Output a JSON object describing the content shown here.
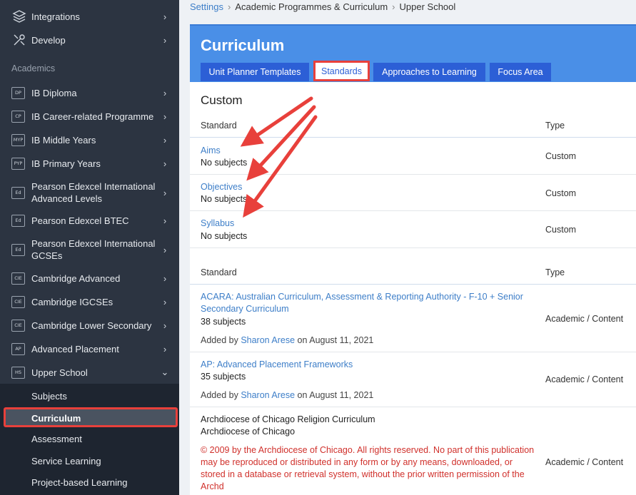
{
  "sidebar": {
    "top_items": [
      {
        "label": "Integrations",
        "icon": "layers-icon"
      },
      {
        "label": "Develop",
        "icon": "tools-icon"
      }
    ],
    "section_heading": "Academics",
    "programmes": [
      {
        "badge": "DP",
        "label": "IB Diploma"
      },
      {
        "badge": "CP",
        "label": "IB Career-related Programme"
      },
      {
        "badge": "MYP",
        "label": "IB Middle Years"
      },
      {
        "badge": "PYP",
        "label": "IB Primary Years"
      },
      {
        "badge": "Ed",
        "label": "Pearson Edexcel International Advanced Levels"
      },
      {
        "badge": "Ed",
        "label": "Pearson Edexcel BTEC"
      },
      {
        "badge": "Ed",
        "label": "Pearson Edexcel International GCSEs"
      },
      {
        "badge": "CIE",
        "label": "Cambridge Advanced"
      },
      {
        "badge": "CIE",
        "label": "Cambridge IGCSEs"
      },
      {
        "badge": "CIE",
        "label": "Cambridge Lower Secondary"
      },
      {
        "badge": "AP",
        "label": "Advanced Placement"
      },
      {
        "badge": "HS",
        "label": "Upper School"
      }
    ],
    "submenu": [
      "Subjects",
      "Curriculum",
      "Assessment",
      "Service Learning",
      "Project-based Learning"
    ]
  },
  "breadcrumb": {
    "root": "Settings",
    "middle": "Academic Programmes & Curriculum",
    "current": "Upper School",
    "separator": "›"
  },
  "panel": {
    "title": "Curriculum",
    "tabs": [
      "Unit Planner Templates",
      "Standards",
      "Approaches to Learning",
      "Focus Area"
    ],
    "active_tab": "Standards"
  },
  "custom": {
    "heading": "Custom",
    "col_standard": "Standard",
    "col_type": "Type",
    "rows": [
      {
        "name": "Aims",
        "subjects": "No subjects",
        "type": "Custom"
      },
      {
        "name": "Objectives",
        "subjects": "No subjects",
        "type": "Custom"
      },
      {
        "name": "Syllabus",
        "subjects": "No subjects",
        "type": "Custom"
      }
    ]
  },
  "standards": {
    "col_standard": "Standard",
    "col_type": "Type",
    "rows": [
      {
        "name": "ACARA: Australian Curriculum, Assessment & Reporting Authority - F-10 + Senior Secondary Curriculum",
        "subjects": "38 subjects",
        "added_prefix": "Added by",
        "added_by": "Sharon Arese",
        "added_suffix": "on August 11, 2021",
        "type": "Academic / Content"
      },
      {
        "name": "AP: Advanced Placement Frameworks",
        "subjects": "35 subjects",
        "added_prefix": "Added by",
        "added_by": "Sharon Arese",
        "added_suffix": "on August 11, 2021",
        "type": "Academic / Content"
      },
      {
        "name": "Archdiocese of Chicago Religion Curriculum",
        "publisher": "Archdiocese of Chicago",
        "notice": "© 2009 by the Archdiocese of Chicago. All rights reserved. No part of this publication may be reproduced or distributed in any form or by any means, downloaded, or stored in a database or retrieval system, without the prior written permission of the Archd",
        "type": "Academic / Content"
      }
    ]
  },
  "colors": {
    "sidebar_bg": "#2c3441",
    "header_blue": "#4a8fe7",
    "tab_blue": "#2c5fd6",
    "link_blue": "#3d7ec8",
    "annotation_red": "#e8403b"
  }
}
